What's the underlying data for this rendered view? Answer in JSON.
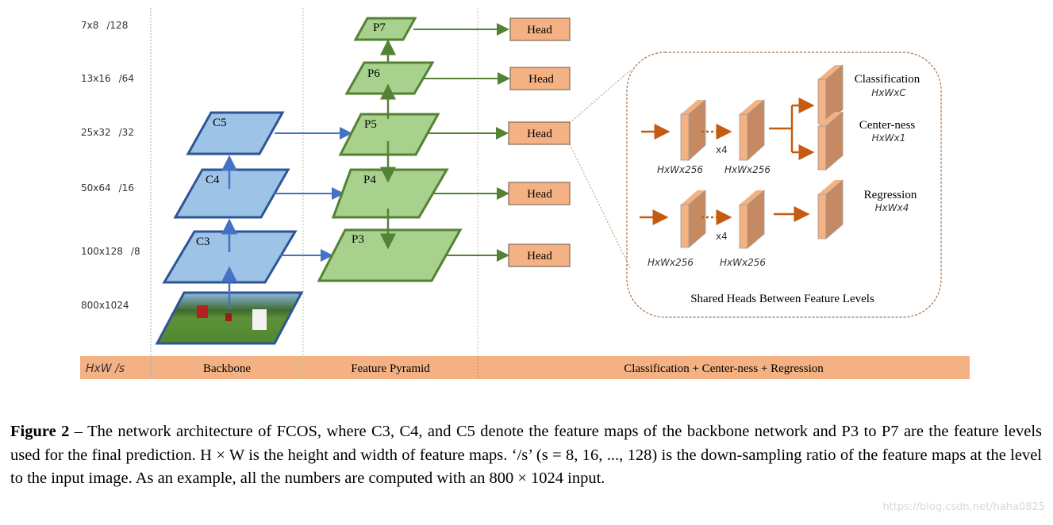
{
  "levels": [
    {
      "size": "7x8",
      "stride": "/128"
    },
    {
      "size": "13x16",
      "stride": "/64"
    },
    {
      "size": "25x32",
      "stride": "/32"
    },
    {
      "size": "50x64",
      "stride": "/16"
    },
    {
      "size": "100x128",
      "stride": "/8"
    },
    {
      "size": "800x1024",
      "stride": ""
    }
  ],
  "backbone": {
    "maps": [
      "C5",
      "C4",
      "C3"
    ],
    "input_image": "input-photo-soccer-players"
  },
  "pyramid": {
    "maps": [
      "P7",
      "P6",
      "P5",
      "P4",
      "P3"
    ]
  },
  "heads": {
    "label": "Head",
    "count": 5
  },
  "shared_heads": {
    "title": "Shared Heads Between Feature Levels",
    "repeat": "x4",
    "feature_dim": "HxWx256",
    "outputs": [
      {
        "name": "Classification",
        "dim": "HxWxC"
      },
      {
        "name": "Center-ness",
        "dim": "HxWx1"
      },
      {
        "name": "Regression",
        "dim": "HxWx4"
      }
    ]
  },
  "bottom_bar": {
    "col0": "HxW /s",
    "col1": "Backbone",
    "col2": "Feature Pyramid",
    "col3": "Classification + Center-ness + Regression"
  },
  "colors": {
    "backbone_fill": "#9dc3e6",
    "backbone_stroke": "#2e5597",
    "backbone_arrow": "#4472c4",
    "pyramid_fill": "#a9d18e",
    "pyramid_stroke": "#548235",
    "head_fill": "#f4b183",
    "head_arrow": "#c55a11",
    "bar_fill": "#f4b183"
  },
  "caption": {
    "label": "Figure 2",
    "text": " – The network architecture of FCOS, where C3, C4, and C5 denote the feature maps of the backbone network and P3 to P7 are the feature levels used for the final prediction. H × W is the height and width of feature maps. ‘/s’ (s = 8, 16, ..., 128) is the down-sampling ratio of the feature maps at the level to the input image. As an example, all the numbers are computed with an 800 × 1024 input."
  },
  "watermark": "https://blog.csdn.net/haha0825"
}
